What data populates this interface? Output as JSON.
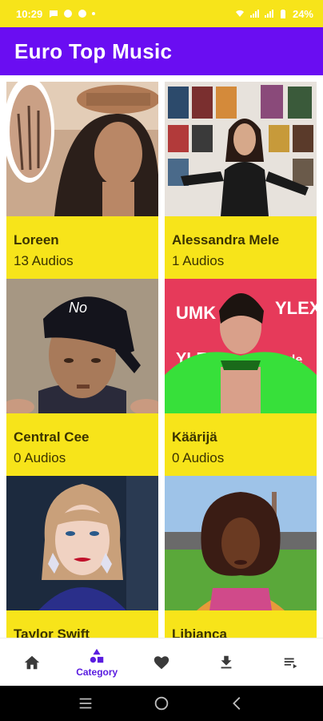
{
  "status_bar": {
    "time": "10:29",
    "battery": "24%"
  },
  "app": {
    "title": "Euro Top Music"
  },
  "artists": [
    {
      "name": "Loreen",
      "count": "13 Audios"
    },
    {
      "name": "Alessandra Mele",
      "count": "1 Audios"
    },
    {
      "name": "Central Cee",
      "count": "0 Audios"
    },
    {
      "name": "Käärijä",
      "count": "0 Audios"
    },
    {
      "name": "Taylor Swift",
      "count": ""
    },
    {
      "name": "Libianca",
      "count": ""
    }
  ],
  "bottom_nav": {
    "active_label": "Category",
    "items": [
      "home-icon",
      "category-icon",
      "heart-icon",
      "download-icon",
      "playlist-icon"
    ]
  },
  "colors": {
    "app_bar": "#6a0df2",
    "card": "#f7e41a",
    "status_bar": "#f7e41a",
    "accent": "#5a1ce0"
  }
}
